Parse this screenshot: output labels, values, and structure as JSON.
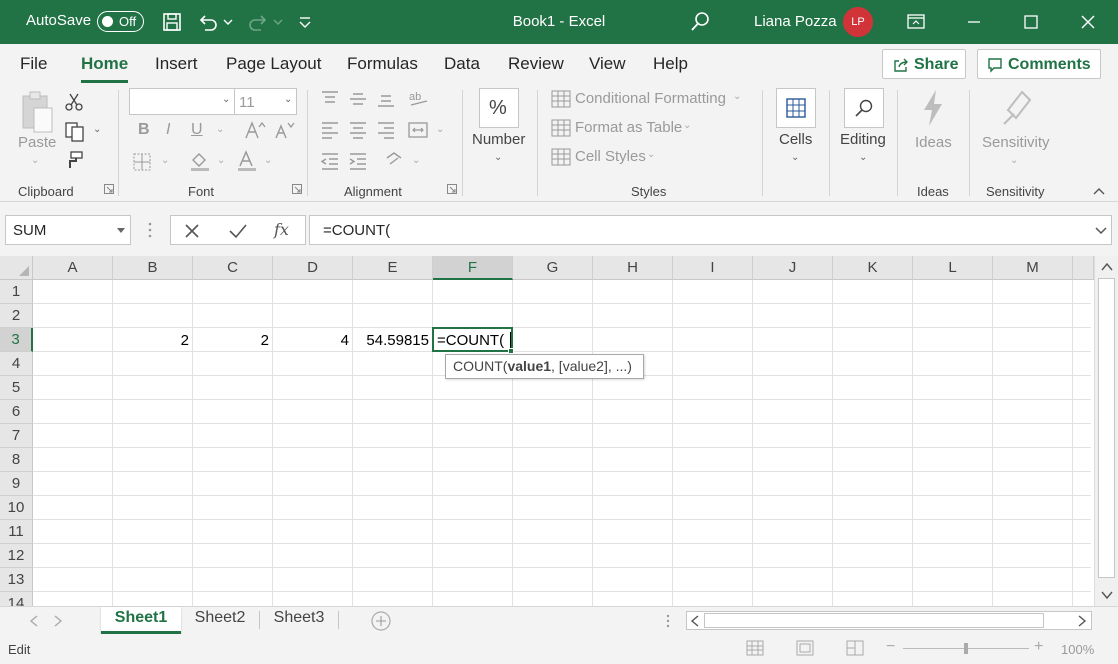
{
  "colors": {
    "accent": "#217346",
    "avatar": "#d13438",
    "ribbon_bg": "#f3f3f3"
  },
  "titlebar": {
    "autosave_label": "AutoSave",
    "autosave_state": "Off",
    "title": "Book1  -  Excel",
    "user_name": "Liana Pozza",
    "user_initials": "LP"
  },
  "menu": {
    "tabs": [
      {
        "label": "File"
      },
      {
        "label": "Home"
      },
      {
        "label": "Insert"
      },
      {
        "label": "Page Layout"
      },
      {
        "label": "Formulas"
      },
      {
        "label": "Data"
      },
      {
        "label": "Review"
      },
      {
        "label": "View"
      },
      {
        "label": "Help"
      }
    ],
    "active_tab": "Home",
    "share_label": "Share",
    "comments_label": "Comments"
  },
  "ribbon": {
    "clipboard": {
      "paste_label": "Paste",
      "group_label": "Clipboard"
    },
    "font": {
      "font_name": "",
      "font_size": "11",
      "group_label": "Font",
      "bold": "B",
      "italic": "I",
      "underline": "U"
    },
    "alignment": {
      "group_label": "Alignment"
    },
    "number": {
      "label": "Number",
      "icon_text": "%"
    },
    "styles": {
      "conditional_formatting": "Conditional Formatting",
      "format_as_table": "Format as Table",
      "cell_styles": "Cell Styles",
      "group_label": "Styles"
    },
    "cells": {
      "label": "Cells"
    },
    "editing": {
      "label": "Editing"
    },
    "ideas": {
      "label": "Ideas",
      "group_label": "Ideas"
    },
    "sensitivity": {
      "label": "Sensitivity",
      "group_label": "Sensitivity"
    }
  },
  "formula_bar": {
    "name_box": "SUM",
    "formula": "=COUNT("
  },
  "grid": {
    "columns": [
      "A",
      "B",
      "C",
      "D",
      "E",
      "F",
      "G",
      "H",
      "I",
      "J",
      "K",
      "L",
      "M"
    ],
    "rows": [
      "1",
      "2",
      "3",
      "4",
      "5",
      "6",
      "7",
      "8",
      "9",
      "10",
      "11",
      "12",
      "13",
      "14"
    ],
    "selected_column": "F",
    "selected_row": "3",
    "cells": {
      "B3": "2",
      "C3": "2",
      "D3": "4",
      "E3": "54.59815"
    },
    "active_cell_text": "=COUNT(",
    "tooltip": {
      "fn": "COUNT(",
      "arg1": "value1",
      "rest": ", [value2], ...)"
    }
  },
  "sheets": {
    "tabs": [
      {
        "label": "Sheet1"
      },
      {
        "label": "Sheet2"
      },
      {
        "label": "Sheet3"
      }
    ],
    "active": "Sheet1"
  },
  "status": {
    "mode": "Edit",
    "zoom": "100%"
  }
}
